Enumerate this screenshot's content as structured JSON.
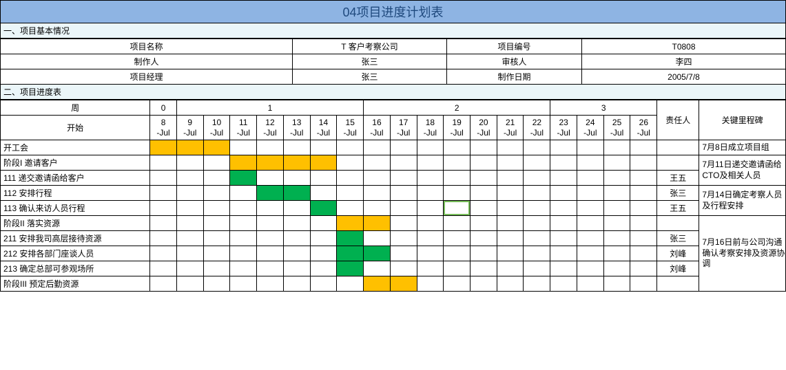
{
  "title": "04项目进度计划表",
  "sections": {
    "s1": "一、项目基本情况",
    "s2": "二、项目进度表"
  },
  "info": {
    "r1": {
      "l1": "项目名称",
      "v1": "T 客户考察公司",
      "l2": "项目编号",
      "v2": "T0808"
    },
    "r2": {
      "l1": "制作人",
      "v1": "张三",
      "l2": "审核人",
      "v2": "李四"
    },
    "r3": {
      "l1": "项目经理",
      "v1": "张三",
      "l2": "制作日期",
      "v2": "2005/7/8"
    }
  },
  "head": {
    "week_label": "周",
    "start_label": "开始",
    "weeks": [
      "0",
      "1",
      "2",
      "3"
    ],
    "owner": "责任人",
    "milestone": "关键里程碑"
  },
  "dates": [
    {
      "d": "8",
      "m": "-Jul"
    },
    {
      "d": "9",
      "m": "-Jul"
    },
    {
      "d": "10",
      "m": "-Jul"
    },
    {
      "d": "11",
      "m": "-Jul"
    },
    {
      "d": "12",
      "m": "-Jul"
    },
    {
      "d": "13",
      "m": "-Jul"
    },
    {
      "d": "14",
      "m": "-Jul"
    },
    {
      "d": "15",
      "m": "-Jul"
    },
    {
      "d": "16",
      "m": "-Jul"
    },
    {
      "d": "17",
      "m": "-Jul"
    },
    {
      "d": "18",
      "m": "-Jul"
    },
    {
      "d": "19",
      "m": "-Jul"
    },
    {
      "d": "20",
      "m": "-Jul"
    },
    {
      "d": "21",
      "m": "-Jul"
    },
    {
      "d": "22",
      "m": "-Jul"
    },
    {
      "d": "23",
      "m": "-Jul"
    },
    {
      "d": "24",
      "m": "-Jul"
    },
    {
      "d": "25",
      "m": "-Jul"
    },
    {
      "d": "26",
      "m": "-Jul"
    }
  ],
  "rows": [
    {
      "task": "开工会",
      "owner": "",
      "cells": {
        "0": "orange",
        "1": "orange",
        "2": "orange"
      }
    },
    {
      "task": "阶段I 邀请客户",
      "owner": "",
      "cells": {
        "3": "orange",
        "4": "orange",
        "5": "orange",
        "6": "orange"
      }
    },
    {
      "task": "111 递交邀请函给客户",
      "owner": "王五",
      "cells": {
        "3": "green"
      }
    },
    {
      "task": "112 安排行程",
      "owner": "张三",
      "cells": {
        "4": "green",
        "5": "green"
      }
    },
    {
      "task": "113 确认来访人员行程",
      "owner": "王五",
      "cells": {
        "6": "green"
      },
      "sel": 11
    },
    {
      "task": "阶段II 落实资源",
      "owner": "",
      "cells": {
        "7": "orange",
        "8": "orange"
      }
    },
    {
      "task": "211 安排我司高层接待资源",
      "owner": "张三",
      "cells": {
        "7": "green"
      }
    },
    {
      "task": "212 安排各部门座谈人员",
      "owner": "刘峰",
      "cells": {
        "7": "green",
        "8": "green"
      }
    },
    {
      "task": "213 确定总部可参观场所",
      "owner": "刘峰",
      "cells": {
        "7": "green"
      }
    },
    {
      "task": "阶段III 预定后勤资源",
      "owner": "",
      "cells": {
        "8": "orange",
        "9": "orange"
      }
    }
  ],
  "milestones": [
    {
      "start": 0,
      "span": 1,
      "text": "7月8日成立项目组"
    },
    {
      "start": 1,
      "span": 2,
      "text": "7月11日递交邀请函给CTO及相关人员"
    },
    {
      "start": 3,
      "span": 2,
      "text": "7月14日确定考察人员及行程安排"
    },
    {
      "start": 5,
      "span": 5,
      "text": "7月16日前与公司沟通确认考察安排及资源协调"
    }
  ]
}
